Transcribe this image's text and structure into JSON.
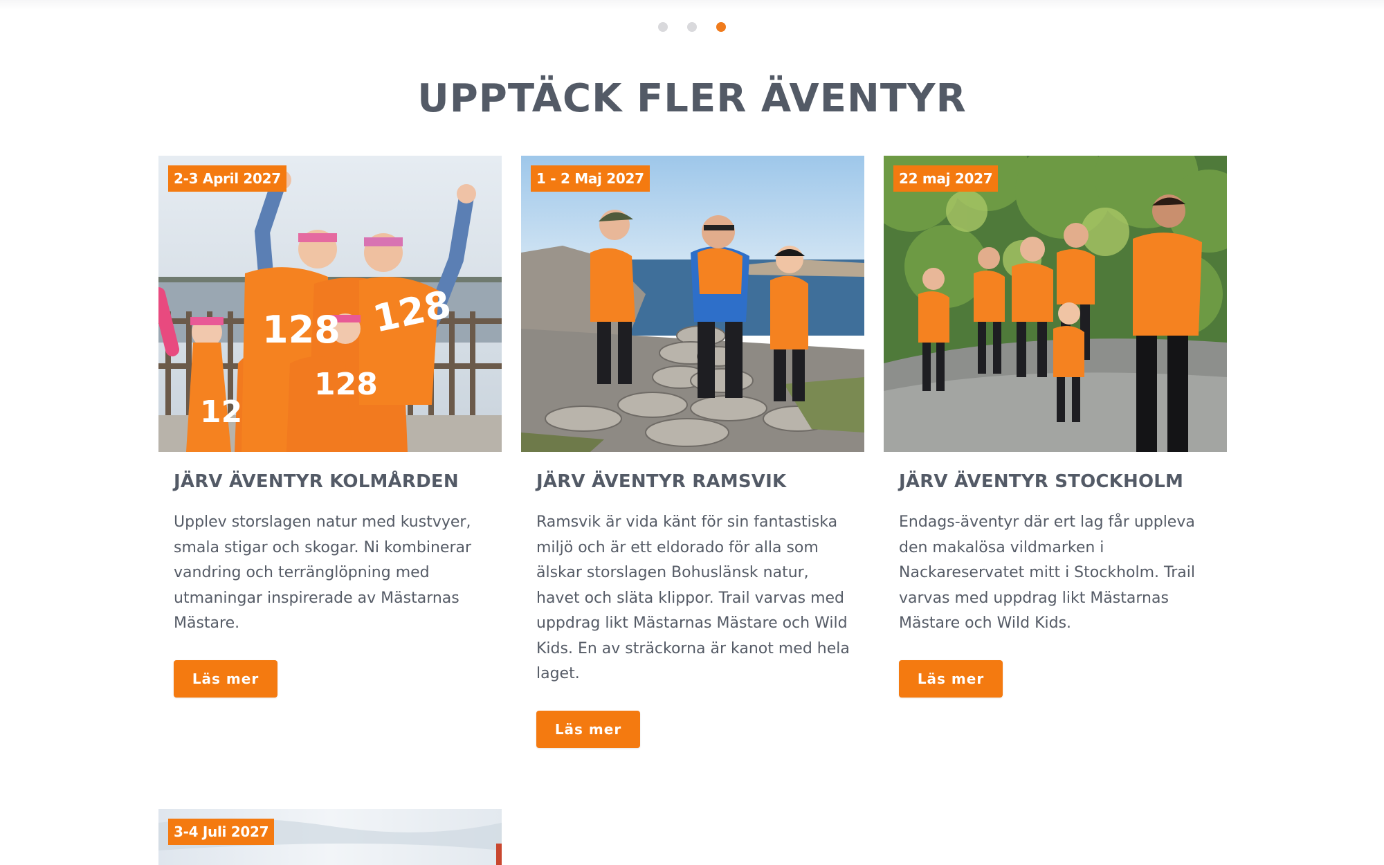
{
  "carousel": {
    "dots": 3,
    "active_index": 2
  },
  "section": {
    "title": "UPPTÄCK FLER ÄVENTYR"
  },
  "cards": [
    {
      "date": "2-3 April 2027",
      "title": "JÄRV ÄVENTYR KOLMÅRDEN",
      "description": "Upplev storslagen natur med kustvyer, smala stigar och skogar. Ni kombinerar vandring och terränglöpning med utmaningar inspirerade av Mästarnas Mästare.",
      "button": "Läs mer",
      "photo_text": "128"
    },
    {
      "date": "1 - 2 Maj 2027",
      "title": "JÄRV ÄVENTYR RAMSVIK",
      "description": "Ramsvik är vida känt för sin fantastiska miljö och är ett eldorado för alla som älskar storslagen Bohuslänsk natur, havet och släta klippor. Trail varvas med uppdrag likt Mästarnas Mästare och Wild Kids. En av sträckorna är kanot med hela laget.",
      "button": "Läs mer"
    },
    {
      "date": "22 maj 2027",
      "title": "JÄRV ÄVENTYR STOCKHOLM",
      "description": "Endags-äventyr där ert lag får uppleva den makalösa vildmarken i Nackareservatet mitt i Stockholm. Trail varvas med uppdrag likt Mästarnas Mästare och Wild Kids.",
      "button": "Läs mer"
    },
    {
      "date": "3-4 Juli 2027"
    }
  ],
  "colors": {
    "accent": "#f47a10",
    "heading": "#535a66",
    "text": "#555b66",
    "dot_inactive": "#d9d9dc",
    "dot_active": "#f07b1c"
  }
}
